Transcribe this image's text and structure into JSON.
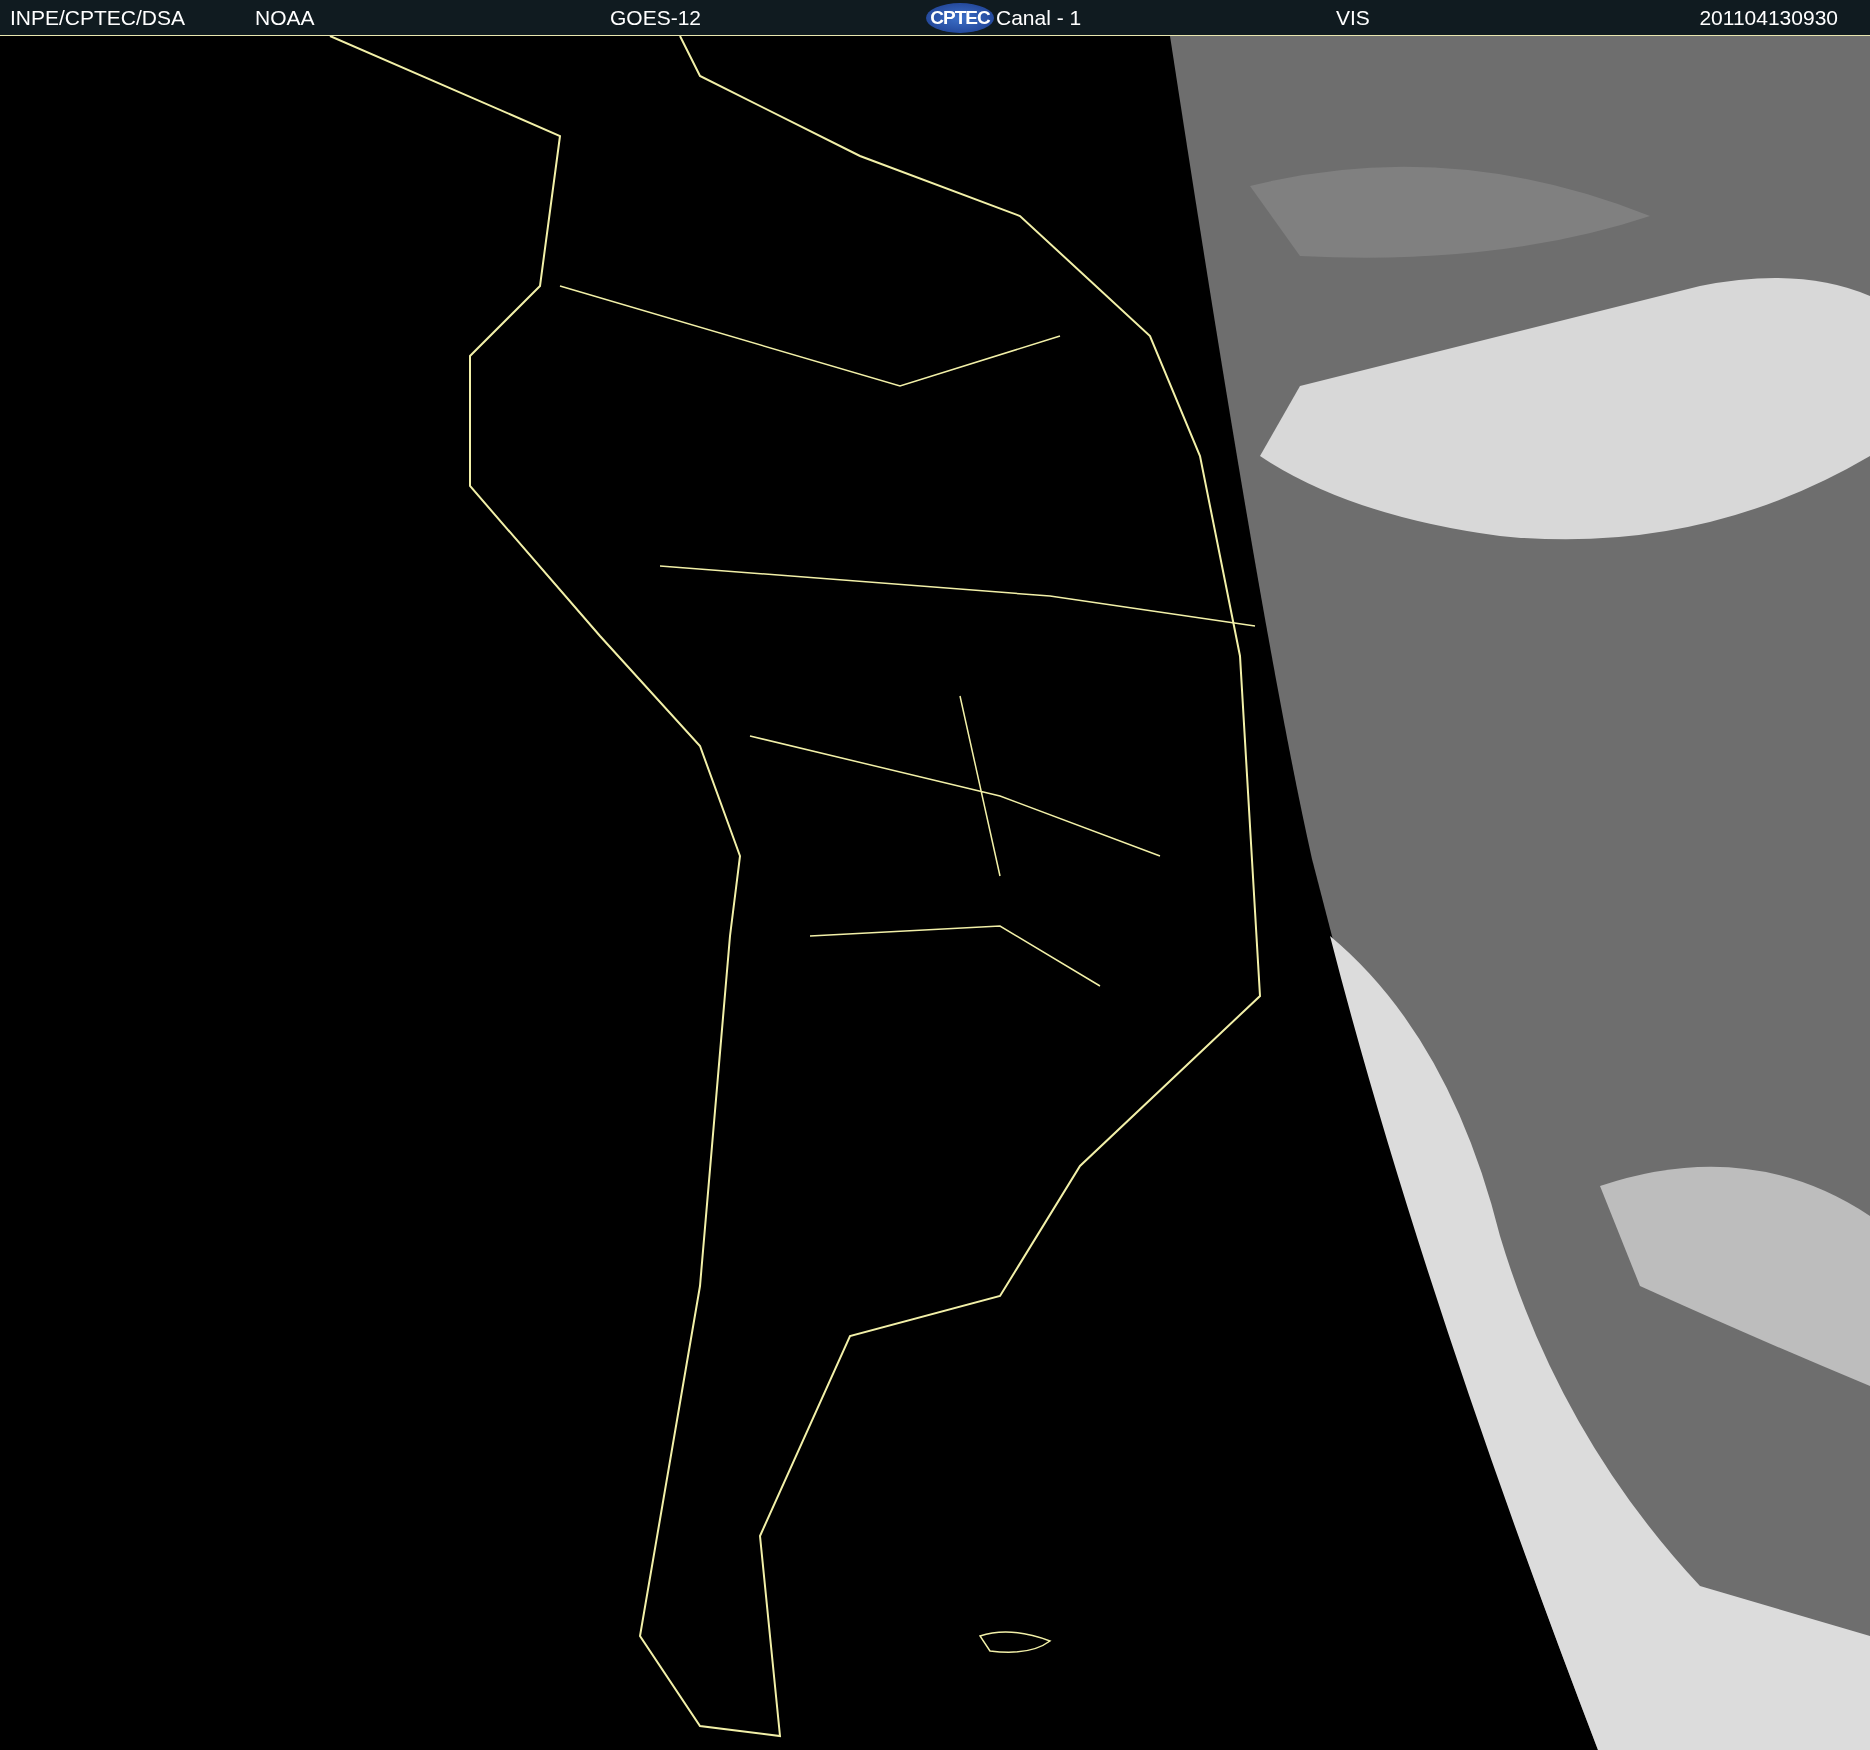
{
  "header": {
    "source": "INPE/CPTEC/DSA",
    "agency": "NOAA",
    "satellite": "GOES-12",
    "logo": "CPTEC",
    "channel": "Canal - 1",
    "band": "VIS",
    "timestamp": "201104130930"
  }
}
